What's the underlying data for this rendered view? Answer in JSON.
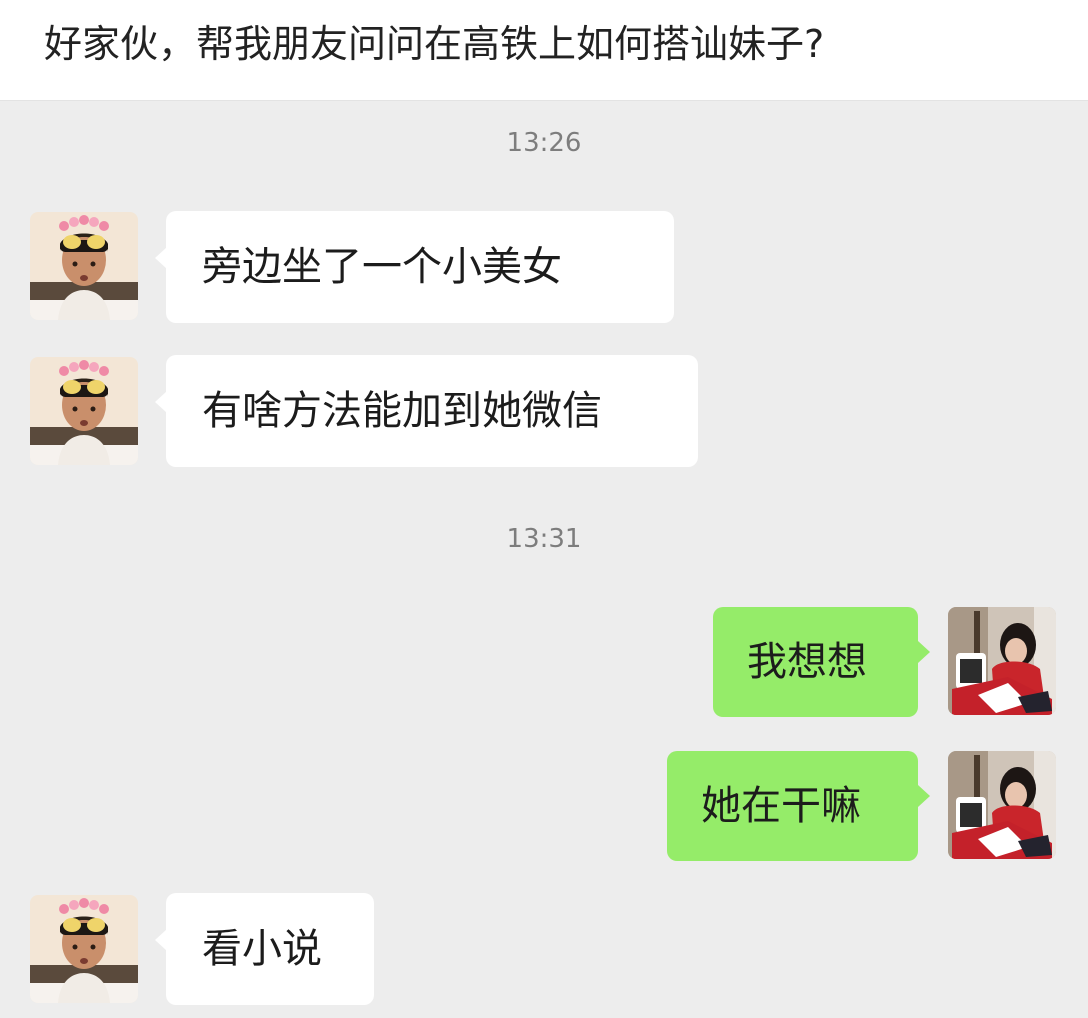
{
  "caption": {
    "text": "好家伙，帮我朋友问问在高铁上如何搭讪妹子?"
  },
  "chat": {
    "timestamps": [
      "13:26",
      "13:31"
    ],
    "messages": [
      {
        "side": "in",
        "text": "旁边坐了一个小美女",
        "avatar": "friend-avatar"
      },
      {
        "side": "in",
        "text": "有啥方法能加到她微信",
        "avatar": "friend-avatar"
      },
      {
        "side": "out",
        "text": "我想想",
        "avatar": "self-avatar"
      },
      {
        "side": "out",
        "text": "她在干嘛",
        "avatar": "self-avatar"
      },
      {
        "side": "in",
        "text": "看小说",
        "avatar": "friend-avatar"
      }
    ]
  },
  "colors": {
    "background": "#ededed",
    "incoming_bubble": "#ffffff",
    "outgoing_bubble": "#95ec69",
    "timestamp_text": "#7d7d7d"
  }
}
